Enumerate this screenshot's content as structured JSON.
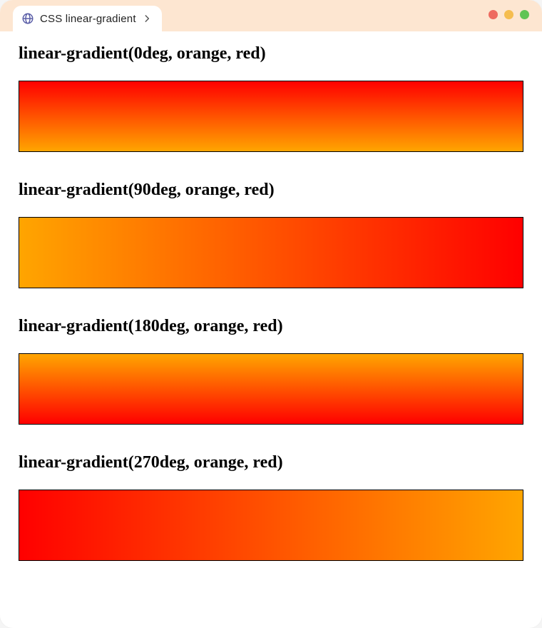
{
  "tab": {
    "title": "CSS linear-gradient"
  },
  "examples": [
    {
      "heading": "linear-gradient(0deg, orange, red)",
      "angle_deg": 0,
      "from": "orange",
      "to": "red"
    },
    {
      "heading": "linear-gradient(90deg, orange, red)",
      "angle_deg": 90,
      "from": "orange",
      "to": "red"
    },
    {
      "heading": "linear-gradient(180deg, orange, red)",
      "angle_deg": 180,
      "from": "orange",
      "to": "red"
    },
    {
      "heading": "linear-gradient(270deg, orange, red)",
      "angle_deg": 270,
      "from": "orange",
      "to": "red"
    }
  ],
  "colors": {
    "titlebar_bg": "#fde6d1"
  }
}
